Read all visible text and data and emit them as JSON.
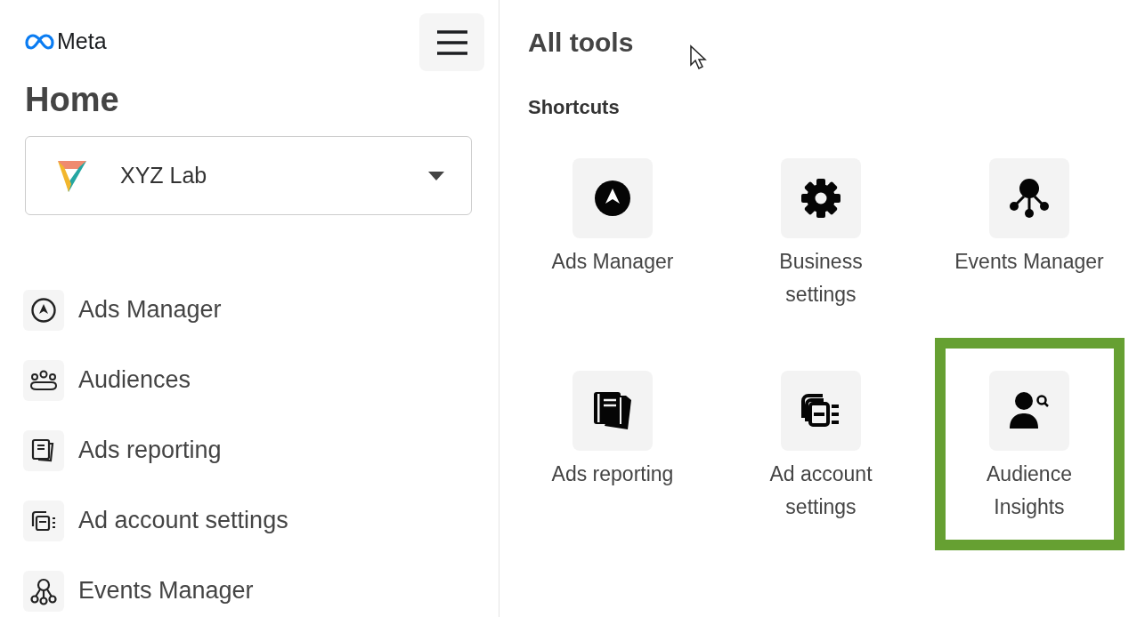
{
  "sidebar": {
    "logo": "Meta",
    "title": "Home",
    "account": {
      "name": "XYZ Lab"
    },
    "items": [
      {
        "kind": "ads",
        "label": "Ads Manager"
      },
      {
        "kind": "audiences",
        "label": "Audiences"
      },
      {
        "kind": "reporting",
        "label": "Ads reporting"
      },
      {
        "kind": "account",
        "label": "Ad account settings"
      },
      {
        "kind": "events",
        "label": "Events Manager"
      }
    ]
  },
  "main": {
    "title": "All tools",
    "section": "Shortcuts",
    "shortcuts": [
      {
        "kind": "ads",
        "label": "Ads Manager",
        "highlighted": false
      },
      {
        "kind": "settings",
        "label": "Business settings",
        "highlighted": false
      },
      {
        "kind": "events",
        "label": "Events Manager",
        "highlighted": false
      },
      {
        "kind": "reporting",
        "label": "Ads reporting",
        "highlighted": false
      },
      {
        "kind": "account",
        "label": "Ad account settings",
        "highlighted": false
      },
      {
        "kind": "insights",
        "label": "Audience Insights",
        "highlighted": true
      }
    ]
  }
}
